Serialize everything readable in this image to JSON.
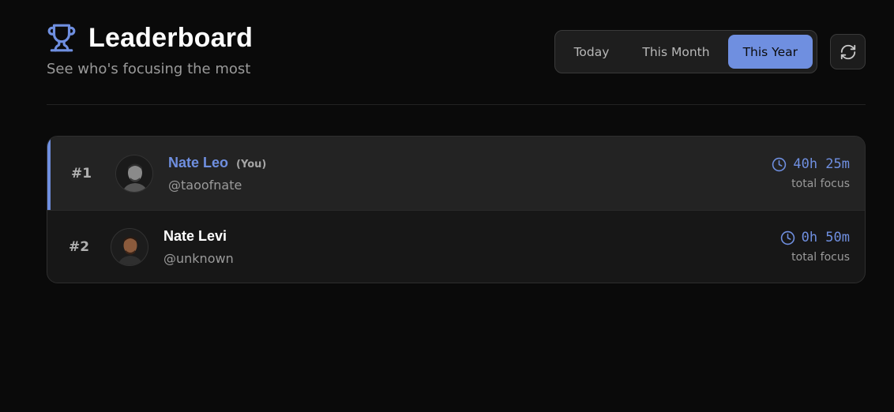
{
  "header": {
    "title": "Leaderboard",
    "subtitle": "See who's focusing the most",
    "icon": "trophy-icon"
  },
  "filters": {
    "options": [
      "Today",
      "This Month",
      "This Year"
    ],
    "selected": "This Year"
  },
  "refresh": {
    "icon": "refresh-icon"
  },
  "colors": {
    "accent": "#6f8fe0",
    "background": "#0a0a0a",
    "card": "#171717",
    "highlight_row": "#232323"
  },
  "leaderboard": [
    {
      "rank": "#1",
      "name": "Nate Leo",
      "you_tag": "(You)",
      "handle": "@taoofnate",
      "time": "40h 25m",
      "label": "total focus"
    },
    {
      "rank": "#2",
      "name": "Nate Levi",
      "handle": "@unknown",
      "time": "0h 50m",
      "label": "total focus"
    }
  ]
}
